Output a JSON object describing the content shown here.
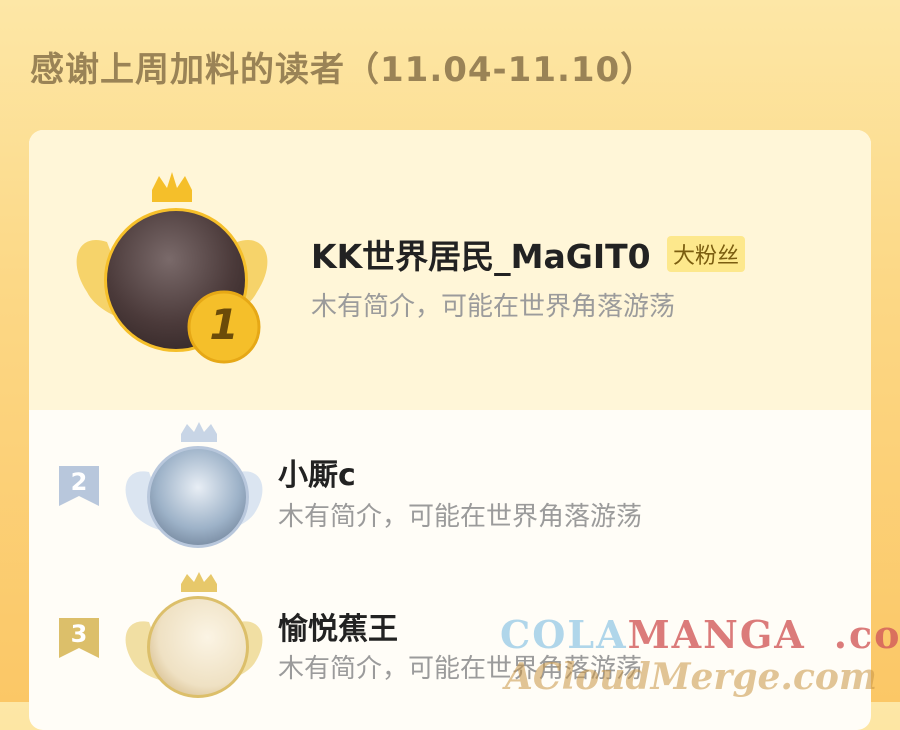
{
  "header": {
    "title": "感谢上周加料的读者（11.04-11.10）"
  },
  "ranking": [
    {
      "rank": "1",
      "name": "KK世界居民_MaGIT0",
      "badge": "大粉丝",
      "bio": "木有简介，可能在世界角落游荡"
    },
    {
      "rank": "2",
      "name": "小厮c",
      "bio": "木有简介，可能在世界角落游荡"
    },
    {
      "rank": "3",
      "name": "愉悦蕉王",
      "bio": "木有简介，可能在世界角落游荡"
    }
  ],
  "watermarks": {
    "line1_part_a": "COLA",
    "line1_part_b": "MANGA",
    "line1_part_c": ".com",
    "line2": "ACloudMerge.com"
  },
  "colors": {
    "gold": "#f5bf2a",
    "silver": "#b8c7dc",
    "bronze": "#dcbf6a"
  }
}
